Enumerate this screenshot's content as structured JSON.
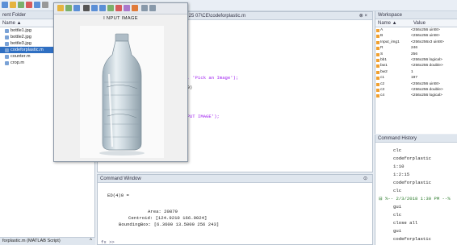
{
  "file_browser": {
    "title": "rent Folder",
    "column_name": "Name ▲",
    "files": [
      {
        "name": "bottle1.jpg",
        "selected": false
      },
      {
        "name": "bottle2.jpg",
        "selected": false
      },
      {
        "name": "bottle3.jpg",
        "selected": false
      },
      {
        "name": "codeforplastic.m",
        "selected": true
      },
      {
        "name": "counter.m",
        "selected": false
      },
      {
        "name": "crop.m",
        "selected": false
      }
    ],
    "status": "forplastic.m (MATLAB Script)"
  },
  "editor": {
    "title": "Matlab Project code 2018 25 07\\CE\\codeforplastic.m",
    "code_lines": [
      {
        "text": "image",
        "color": "#228b22"
      },
      {
        "text": "e,U] = uigetfile('*.jpg', 'Pick an Image');",
        "color": "#a020f0"
      },
      {
        "text": "e,U) | isequal(pathname,0)",
        "color": "#222222"
      },
      {
        "text": "essed cancel')",
        "color": "#a020f0"
      },
      {
        "text": "ead(filename);",
        "color": "#222222"
      },
      {
        "text": "ew(Input_img);title('I  NPUT IMAGE');",
        "color": "#a020f0"
      },
      {
        "text": "_img);",
        "color": "#222222"
      },
      {
        "text": "e(in_image);",
        "color": "#222222"
      },
      {
        "text": "b2gray(in_image);",
        "color": "#222222"
      },
      {
        "text": "_image",
        "color": "#222222"
      }
    ]
  },
  "command_window": {
    "title": "Command Window",
    "lines": [
      "ED(4)0 =",
      "Area: 20879",
      "Centroid: [124.9210 166.9024]",
      "BoundingBox: [6.3600 13.5000 256 243]"
    ],
    "prompt": "fx >>"
  },
  "workspace": {
    "title": "Workspace",
    "col_name": "Name ▲",
    "col_value": "Value",
    "rows": [
      {
        "name": "A",
        "value": "<256x256 uint8>"
      },
      {
        "name": "B",
        "value": "<256x256 uint8>"
      },
      {
        "name": "Input_img1",
        "value": "<256x256x3 uint8>"
      },
      {
        "name": "R",
        "value": "246"
      },
      {
        "name": "S",
        "value": "256"
      },
      {
        "name": "bb1",
        "value": "<256x256 logical>"
      },
      {
        "name": "bw1",
        "value": "<256x256 double>"
      },
      {
        "name": "bw2",
        "value": "1"
      },
      {
        "name": "c1",
        "value": "197"
      },
      {
        "name": "c2",
        "value": "<256x256 uint8>"
      },
      {
        "name": "c3",
        "value": "<256x256 double>"
      },
      {
        "name": "c4",
        "value": "<256x256 logical>"
      }
    ]
  },
  "history": {
    "title": "Command History",
    "lines": [
      "clc",
      "codeforplastic",
      "1:10",
      "1:2:15",
      "codeforplastic",
      "clc",
      "⊟ %-- 2/3/2018 1:30 PM --%",
      "gui",
      "clc",
      "close all",
      "gui",
      "codeforplastic"
    ]
  },
  "figure": {
    "title": "I  NPUT IMAGE"
  }
}
